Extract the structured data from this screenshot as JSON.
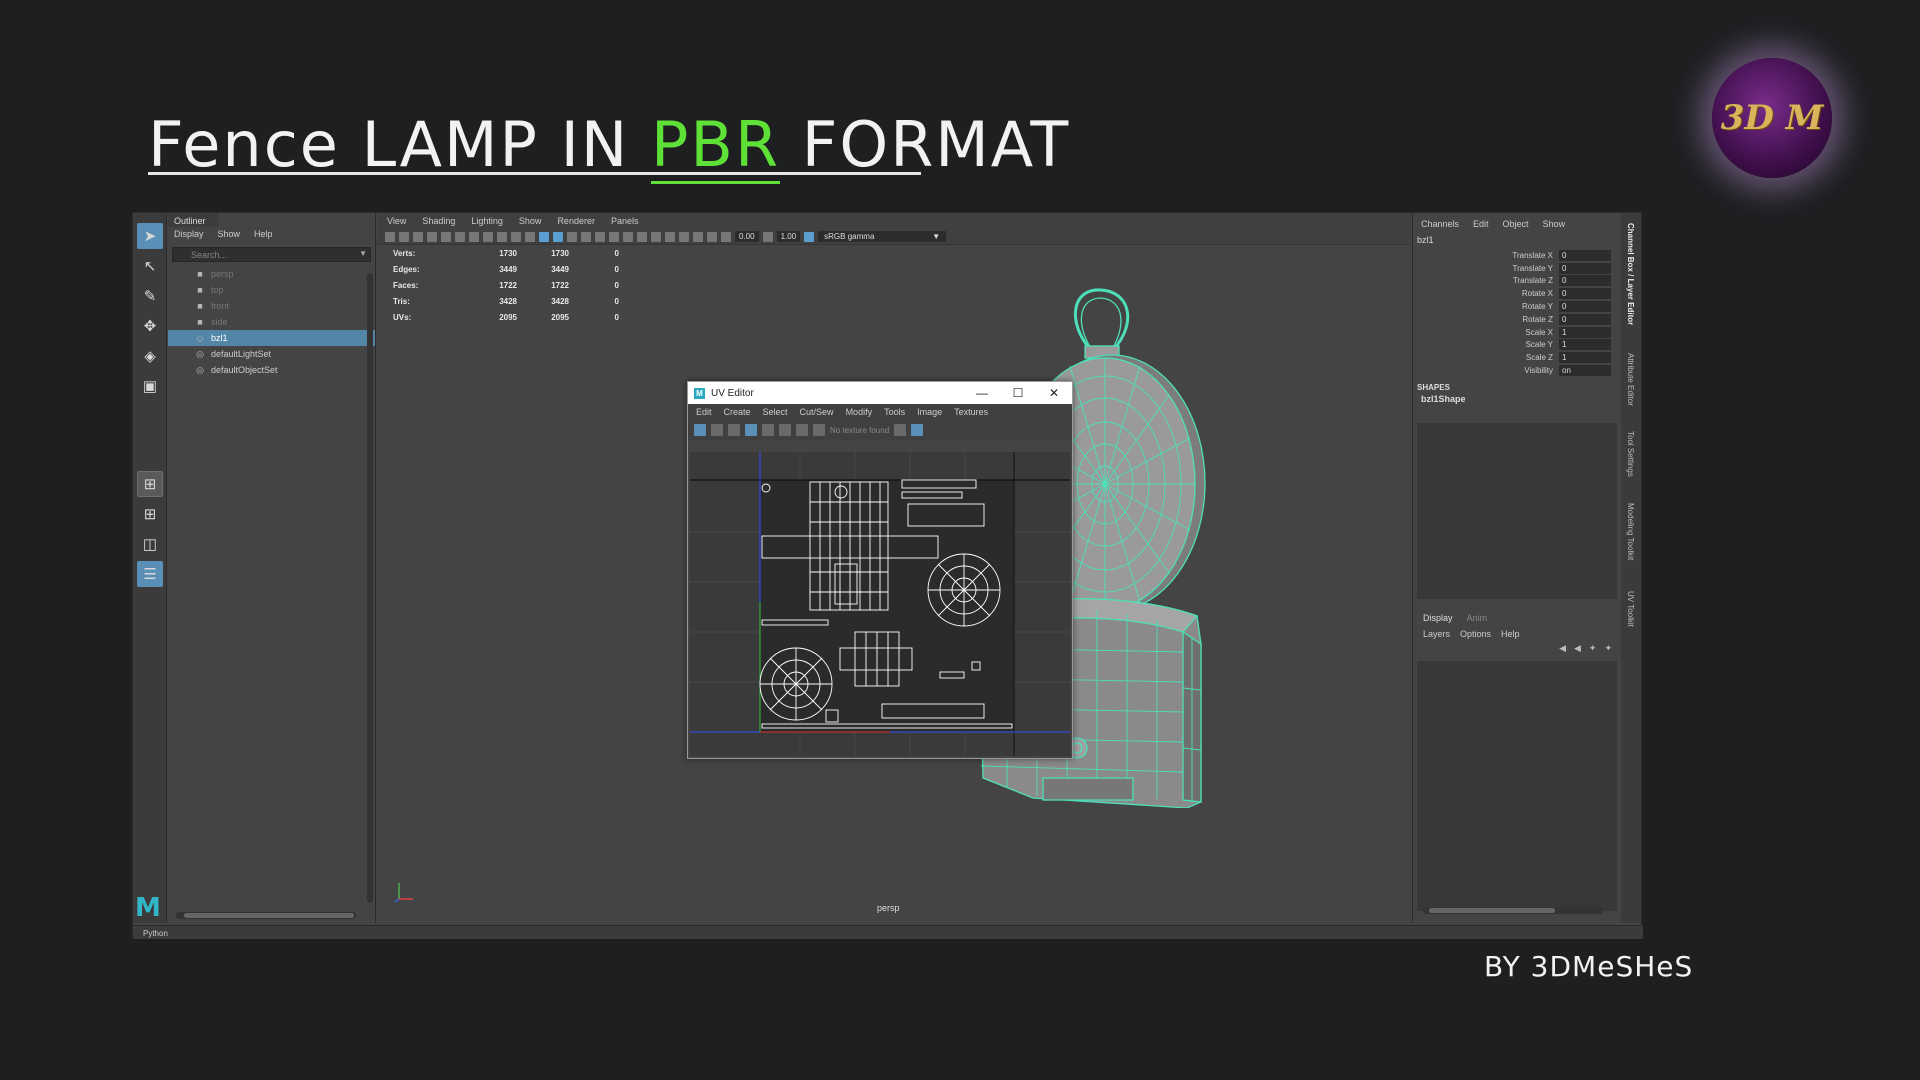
{
  "title": {
    "prefix": "Fence LAMP IN",
    "accent": "PBR",
    "suffix": "FORMAT"
  },
  "logo_text": "3D M",
  "byline": "BY 3DMeSHeS",
  "colors": {
    "accent": "#5fe036",
    "selection": "#5285a6",
    "wireframe": "#4de0b8",
    "logo": "#d9b45a"
  },
  "outliner": {
    "tab": "Outliner",
    "menu": [
      "Display",
      "Show",
      "Help"
    ],
    "search_placeholder": "Search...",
    "items": [
      {
        "label": "persp",
        "icon": "camera-icon",
        "dim": true
      },
      {
        "label": "top",
        "icon": "camera-icon",
        "dim": true
      },
      {
        "label": "front",
        "icon": "camera-icon",
        "dim": true
      },
      {
        "label": "side",
        "icon": "camera-icon",
        "dim": true
      },
      {
        "label": "bzl1",
        "icon": "mesh-icon",
        "selected": true
      },
      {
        "label": "defaultLightSet",
        "icon": "set-icon"
      },
      {
        "label": "defaultObjectSet",
        "icon": "set-icon"
      }
    ]
  },
  "viewport": {
    "menu": [
      "View",
      "Shading",
      "Lighting",
      "Show",
      "Renderer",
      "Panels"
    ],
    "exposure": "0.00",
    "gamma": "1.00",
    "color_space": "sRGB gamma",
    "stats": [
      {
        "label": "Verts:",
        "a": "1730",
        "b": "1730",
        "c": "0"
      },
      {
        "label": "Edges:",
        "a": "3449",
        "b": "3449",
        "c": "0"
      },
      {
        "label": "Faces:",
        "a": "1722",
        "b": "1722",
        "c": "0"
      },
      {
        "label": "Tris:",
        "a": "3428",
        "b": "3428",
        "c": "0"
      },
      {
        "label": "UVs:",
        "a": "2095",
        "b": "2095",
        "c": "0"
      }
    ],
    "camera": "persp"
  },
  "uv_editor": {
    "title": "UV Editor",
    "menu": [
      "Edit",
      "Create",
      "Select",
      "Cut/Sew",
      "Modify",
      "Tools",
      "Image",
      "Textures"
    ],
    "texture_status": "No texture found"
  },
  "channels": {
    "menu": [
      "Channels",
      "Edit",
      "Object",
      "Show"
    ],
    "object": "bzl1",
    "attributes": [
      {
        "label": "Translate X",
        "value": "0"
      },
      {
        "label": "Translate Y",
        "value": "0"
      },
      {
        "label": "Translate Z",
        "value": "0"
      },
      {
        "label": "Rotate X",
        "value": "0"
      },
      {
        "label": "Rotate Y",
        "value": "0"
      },
      {
        "label": "Rotate Z",
        "value": "0"
      },
      {
        "label": "Scale X",
        "value": "1"
      },
      {
        "label": "Scale Y",
        "value": "1"
      },
      {
        "label": "Scale Z",
        "value": "1"
      },
      {
        "label": "Visibility",
        "value": "on"
      }
    ],
    "shapes_header": "SHAPES",
    "shape_name": "bzl1Shape",
    "layer_tabs": [
      "Display",
      "Anim"
    ],
    "layer_menu": [
      "Layers",
      "Options",
      "Help"
    ]
  },
  "side_tabs": [
    "Channel Box / Layer Editor",
    "Attribute Editor",
    "Tool Settings",
    "Modeling Toolkit",
    "UV Toolkit"
  ],
  "statusbar": "Python"
}
